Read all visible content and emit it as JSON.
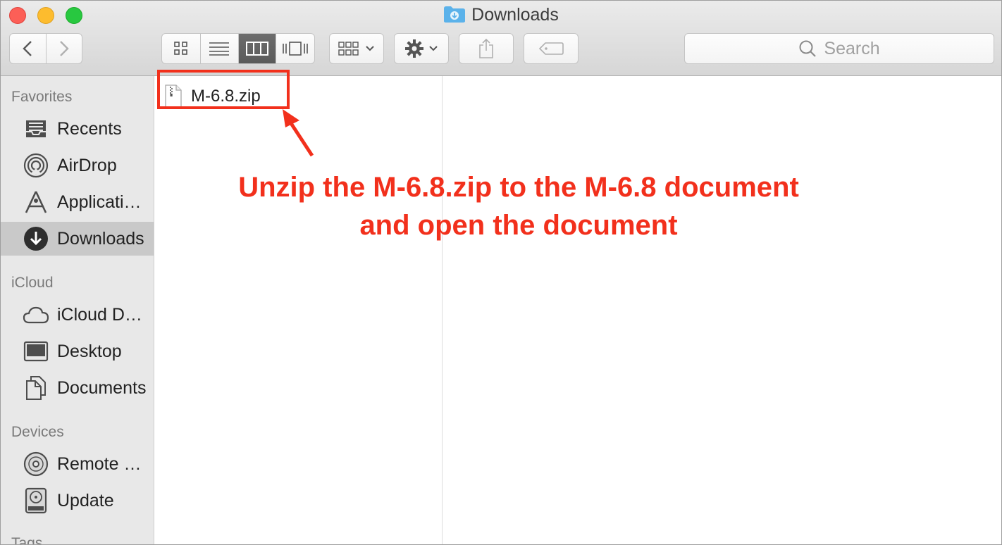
{
  "window": {
    "title": "Downloads"
  },
  "search": {
    "placeholder": "Search"
  },
  "sidebar": {
    "sections": [
      {
        "label": "Favorites"
      },
      {
        "label": "iCloud"
      },
      {
        "label": "Devices"
      },
      {
        "label": "Tags"
      }
    ],
    "favorites": [
      {
        "label": "Recents",
        "icon": "recents-icon"
      },
      {
        "label": "AirDrop",
        "icon": "airdrop-icon"
      },
      {
        "label": "Applications",
        "icon": "applications-icon"
      },
      {
        "label": "Downloads",
        "icon": "downloads-icon",
        "selected": true
      }
    ],
    "icloud": [
      {
        "label": "iCloud Drive",
        "icon": "cloud-icon"
      },
      {
        "label": "Desktop",
        "icon": "desktop-icon"
      },
      {
        "label": "Documents",
        "icon": "documents-icon"
      }
    ],
    "devices": [
      {
        "label": "Remote Disc",
        "icon": "disc-icon"
      },
      {
        "label": "Update",
        "icon": "drive-icon"
      }
    ]
  },
  "files": [
    {
      "name": "M-6.8.zip",
      "icon": "zip-file-icon"
    }
  ],
  "annotation": {
    "line1": "Unzip the M-6.8.zip to the M-6.8 document",
    "line2": "and open the document",
    "color": "#f2301c"
  },
  "colors": {
    "selection": "#c9c9c9",
    "sidebar_bg": "#e8e8e8",
    "folder_blue": "#5bb2ea"
  }
}
